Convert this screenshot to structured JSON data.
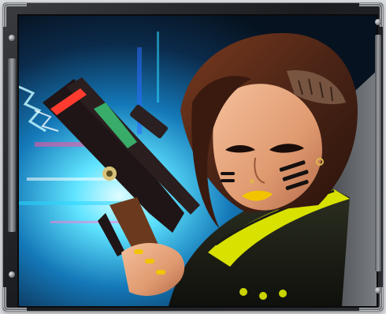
{
  "card": {
    "image_alt": "",
    "colors": {
      "frame_dark": "#1b1c1f",
      "frame_metal": "#8a8d91",
      "neon_cyan": "#28d6ff",
      "neon_blue": "#2a6cff",
      "neon_pink": "#ff4fa0",
      "hair": "#4a2416",
      "skin": "#e6a77f",
      "lips": "#f2c400",
      "jacket": "#1a1c16",
      "collar_trim": "#d8e100",
      "gun_body": "#1f1516",
      "gun_accent": "#ff3b2f"
    },
    "icons": [
      "corner-bracket-icon",
      "rivet-icon"
    ]
  }
}
